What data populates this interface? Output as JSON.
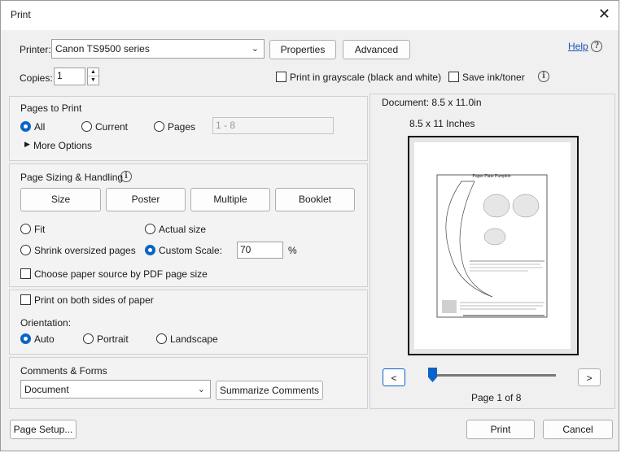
{
  "window": {
    "title": "Print",
    "close_glyph": "✕"
  },
  "printer": {
    "label": "Printer:",
    "selected": "Canon TS9500 series",
    "properties_label": "Properties",
    "advanced_label": "Advanced",
    "help_label": "Help"
  },
  "copies": {
    "label": "Copies:",
    "value": "1",
    "grayscale_label": "Print in grayscale (black and white)",
    "save_ink_label": "Save ink/toner"
  },
  "pages_to_print": {
    "heading": "Pages to Print",
    "all_label": "All",
    "current_label": "Current",
    "pages_label": "Pages",
    "pages_value": "1 - 8",
    "more_options_label": "More Options",
    "selected": "All"
  },
  "page_sizing": {
    "heading": "Page Sizing & Handling",
    "tabs": [
      "Size",
      "Poster",
      "Multiple",
      "Booklet"
    ],
    "fit_label": "Fit",
    "actual_size_label": "Actual size",
    "shrink_label": "Shrink oversized pages",
    "custom_scale_label": "Custom Scale:",
    "custom_scale_value": "70",
    "percent": "%",
    "paper_source_label": "Choose paper source by PDF page size",
    "selected": "Custom Scale"
  },
  "duplex": {
    "both_sides_label": "Print on both sides of paper",
    "orientation_label": "Orientation:",
    "auto_label": "Auto",
    "portrait_label": "Portrait",
    "landscape_label": "Landscape",
    "selected": "Auto"
  },
  "comments_forms": {
    "heading": "Comments & Forms",
    "selected": "Document",
    "summarize_label": "Summarize Comments"
  },
  "preview": {
    "document_size": "Document: 8.5 x 11.0in",
    "paper_size": "8.5 x 11 Inches",
    "sheet_title": "Paper Plate Pumpkin",
    "prev_glyph": "<",
    "next_glyph": ">",
    "page_indicator": "Page 1 of 8",
    "page_position": 0.0
  },
  "footer": {
    "page_setup_label": "Page Setup...",
    "print_label": "Print",
    "cancel_label": "Cancel"
  },
  "colors": {
    "accent": "#0a64c8",
    "link": "#1a52b8"
  }
}
